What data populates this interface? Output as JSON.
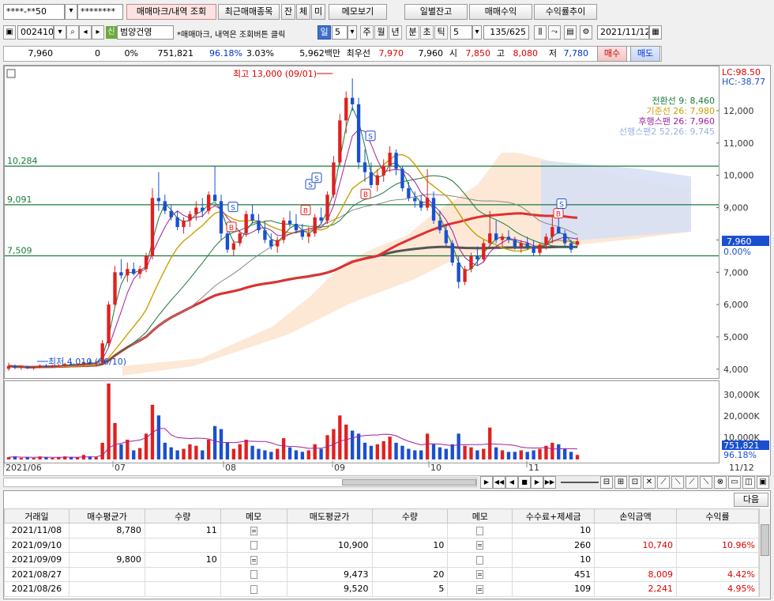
{
  "toolbar": {
    "account_field": "****-**50",
    "password_field": "********",
    "buttons": [
      "매매마크/내역 조회",
      "최근매매종목",
      "잔",
      "체",
      "미",
      "메모보기"
    ],
    "right_buttons": [
      "일별잔고",
      "매매수익",
      "수익률추이"
    ]
  },
  "row2": {
    "code": "002410",
    "credit_tag": "신",
    "stock_name": "범양건영",
    "notice": "*매매마크, 내역은 조회버튼 클릭",
    "period_sel": "일",
    "period_num": "5",
    "periods": [
      "주",
      "월",
      "년",
      "분",
      "초",
      "틱"
    ],
    "tick_num": "5",
    "count": "135/625",
    "date": "2021/11/12"
  },
  "quote": {
    "price": "7,960",
    "change": "0",
    "change_pct": "0%",
    "volume": "751,821",
    "vol_ratio": "96.18%",
    "turnover": "3.03%",
    "amount": "5,962백만",
    "best_label": "최우선",
    "best_ask": "7,970",
    "best_bid": "7,960",
    "open_label": "시",
    "open": "7,850",
    "high_label": "고",
    "high": "8,080",
    "low_label": "저",
    "low": "7,780",
    "buy_btn": "매수",
    "sell_btn": "매도"
  },
  "chart_data": {
    "type": "candlestick",
    "y_ticks": [
      "12,000",
      "11,000",
      "10,000",
      "9,000",
      "8,000",
      "7,000",
      "6,000",
      "5,000",
      "4,000"
    ],
    "vol_ticks": [
      "30,000K",
      "20,000K",
      "10,000K"
    ],
    "x_labels": [
      "2021/06",
      "07",
      "08",
      "09",
      "10",
      "11",
      "11/12"
    ],
    "hlines": [
      {
        "label": "10,284",
        "value": 10284
      },
      {
        "label": "9,091",
        "value": 9091
      },
      {
        "label": "7,509",
        "value": 7509
      }
    ],
    "annotations": {
      "high": "최고 13,000 (09/01)",
      "low": "최저 4,010 (06/10)",
      "lc": "LC:98.50",
      "hc": "HC:-38.77",
      "current": "7,960",
      "current_pct": "0.00%",
      "vol_current": "751,821",
      "vol_pct": "96.18%"
    },
    "legend": [
      {
        "name": "전환선 9: 8,460",
        "color": "#1a7a3a"
      },
      {
        "name": "기준선 26: 7,980",
        "color": "#c8a000"
      },
      {
        "name": "후행스팬 26: 7,960",
        "color": "#a020a0"
      },
      {
        "name": "선행스팬2 52,26: 9,745",
        "color": "#9bb0e0"
      }
    ],
    "candles": [
      [
        4010,
        4200,
        3950,
        4100
      ],
      [
        4100,
        4150,
        4000,
        4050
      ],
      [
        4050,
        4120,
        3980,
        4080
      ],
      [
        4080,
        4100,
        4000,
        4030
      ],
      [
        4030,
        4100,
        3980,
        4060
      ],
      [
        4060,
        4150,
        4020,
        4110
      ],
      [
        4110,
        4160,
        4050,
        4080
      ],
      [
        4080,
        4140,
        4040,
        4100
      ],
      [
        4100,
        4180,
        4060,
        4120
      ],
      [
        4120,
        4200,
        4080,
        4160
      ],
      [
        4160,
        4200,
        4100,
        4130
      ],
      [
        4130,
        4190,
        4090,
        4150
      ],
      [
        4150,
        4260,
        4100,
        4220
      ],
      [
        4220,
        4300,
        4150,
        4180
      ],
      [
        4180,
        4250,
        4120,
        4200
      ],
      [
        4200,
        4900,
        4150,
        4800
      ],
      [
        4800,
        6100,
        4700,
        6000
      ],
      [
        6000,
        7200,
        5900,
        7000
      ],
      [
        7000,
        7400,
        6800,
        6900
      ],
      [
        6900,
        7300,
        6700,
        7100
      ],
      [
        7100,
        7300,
        6900,
        6950
      ],
      [
        6950,
        7200,
        6800,
        7100
      ],
      [
        7100,
        7600,
        7000,
        7500
      ],
      [
        7500,
        9600,
        7400,
        9300
      ],
      [
        9300,
        10100,
        8900,
        9200
      ],
      [
        9200,
        9400,
        8800,
        8900
      ],
      [
        8900,
        9100,
        8600,
        8700
      ],
      [
        8700,
        8900,
        8300,
        8400
      ],
      [
        8400,
        8700,
        8200,
        8600
      ],
      [
        8600,
        8900,
        8400,
        8800
      ],
      [
        8800,
        9200,
        8600,
        9000
      ],
      [
        9000,
        9300,
        8700,
        8900
      ],
      [
        8900,
        9500,
        8800,
        9400
      ],
      [
        9400,
        10300,
        9300,
        9200
      ],
      [
        9200,
        9400,
        8000,
        8200
      ],
      [
        8200,
        8400,
        7600,
        7700
      ],
      [
        7700,
        8000,
        7500,
        7900
      ],
      [
        7900,
        8300,
        7800,
        8200
      ],
      [
        8200,
        8900,
        8100,
        8800
      ],
      [
        8800,
        9100,
        8500,
        8600
      ],
      [
        8600,
        8800,
        8200,
        8300
      ],
      [
        8300,
        8600,
        7900,
        8000
      ],
      [
        8000,
        8200,
        7700,
        7800
      ],
      [
        7800,
        8100,
        7600,
        8000
      ],
      [
        8000,
        8700,
        7900,
        8600
      ],
      [
        8600,
        8900,
        8400,
        8500
      ],
      [
        8500,
        8800,
        8200,
        8300
      ],
      [
        8300,
        8500,
        8000,
        8100
      ],
      [
        8100,
        8400,
        7900,
        8200
      ],
      [
        8200,
        8800,
        8100,
        8700
      ],
      [
        8700,
        9000,
        8500,
        8600
      ],
      [
        8600,
        9500,
        8500,
        9400
      ],
      [
        9400,
        10600,
        9300,
        10400
      ],
      [
        10400,
        11900,
        10300,
        11700
      ],
      [
        11700,
        12600,
        11300,
        12400
      ],
      [
        12400,
        13000,
        12000,
        12200
      ],
      [
        12200,
        12400,
        10200,
        10400
      ],
      [
        10400,
        10800,
        9800,
        10100
      ],
      [
        10100,
        10400,
        9600,
        9700
      ],
      [
        9700,
        10200,
        9500,
        10000
      ],
      [
        10000,
        10500,
        9800,
        10300
      ],
      [
        10300,
        10900,
        10100,
        10700
      ],
      [
        10700,
        10800,
        10000,
        10200
      ],
      [
        10200,
        10300,
        9500,
        9600
      ],
      [
        9600,
        9800,
        9200,
        9300
      ],
      [
        9300,
        9500,
        9000,
        9200
      ],
      [
        9200,
        9400,
        8900,
        9000
      ],
      [
        9000,
        10200,
        8900,
        9300
      ],
      [
        9300,
        9500,
        8500,
        8600
      ],
      [
        8600,
        8900,
        8200,
        8300
      ],
      [
        8300,
        8500,
        7800,
        7900
      ],
      [
        7900,
        8000,
        7200,
        7300
      ],
      [
        7300,
        7500,
        6500,
        6700
      ],
      [
        6700,
        7200,
        6600,
        7100
      ],
      [
        7100,
        7600,
        7000,
        7500
      ],
      [
        7500,
        7800,
        7200,
        7400
      ],
      [
        7400,
        8000,
        7300,
        7900
      ],
      [
        7900,
        8900,
        7800,
        8200
      ],
      [
        8200,
        8600,
        7900,
        8000
      ],
      [
        8000,
        8200,
        7800,
        8100
      ],
      [
        8100,
        8300,
        7900,
        8000
      ],
      [
        8000,
        8100,
        7700,
        7800
      ],
      [
        7800,
        8000,
        7600,
        7900
      ],
      [
        7900,
        8100,
        7700,
        7800
      ],
      [
        7800,
        8000,
        7500,
        7600
      ],
      [
        7600,
        7900,
        7500,
        7850
      ],
      [
        7850,
        8200,
        7700,
        8100
      ],
      [
        8100,
        8700,
        7900,
        8400
      ],
      [
        8400,
        9000,
        8200,
        8200
      ],
      [
        8200,
        8300,
        7800,
        7900
      ],
      [
        7900,
        8000,
        7600,
        7700
      ],
      [
        7850,
        8080,
        7780,
        7960
      ]
    ],
    "volume_pct": [
      3,
      4,
      2,
      3,
      2,
      4,
      3,
      2,
      3,
      4,
      3,
      3,
      6,
      4,
      3,
      22,
      100,
      48,
      20,
      26,
      12,
      15,
      34,
      72,
      58,
      22,
      16,
      12,
      14,
      20,
      18,
      12,
      26,
      44,
      40,
      22,
      14,
      20,
      26,
      18,
      14,
      12,
      10,
      14,
      28,
      16,
      12,
      10,
      12,
      20,
      14,
      32,
      40,
      58,
      46,
      38,
      34,
      22,
      18,
      20,
      24,
      30,
      22,
      18,
      14,
      12,
      12,
      34,
      20,
      16,
      14,
      20,
      34,
      18,
      16,
      12,
      14,
      42,
      16,
      12,
      10,
      10,
      12,
      10,
      12,
      14,
      18,
      22,
      20,
      14,
      10,
      6
    ]
  },
  "chart_bottom": {
    "nav_buttons": [
      "▶",
      "◀◀",
      "◀",
      "■",
      "▶",
      "▶▶"
    ]
  },
  "grid": {
    "next_btn": "다음",
    "headers": [
      "거래일",
      "매수평균가",
      "수량",
      "메모",
      "매도평균가",
      "수량",
      "메모",
      "수수료+제세금",
      "손익금액",
      "수익률"
    ],
    "rows": [
      {
        "date": "2021/11/08",
        "buy_avg": "8,780",
        "buy_qty": "11",
        "buy_memo": true,
        "sell_avg": "",
        "sell_qty": "",
        "sell_memo": false,
        "fee": "10",
        "pnl": "",
        "ret": ""
      },
      {
        "date": "2021/09/10",
        "buy_avg": "",
        "buy_qty": "",
        "buy_memo": false,
        "sell_avg": "10,900",
        "sell_qty": "10",
        "sell_memo": true,
        "fee": "260",
        "pnl": "10,740",
        "ret": "10.96%"
      },
      {
        "date": "2021/09/09",
        "buy_avg": "9,800",
        "buy_qty": "10",
        "buy_memo": true,
        "sell_avg": "",
        "sell_qty": "",
        "sell_memo": false,
        "fee": "10",
        "pnl": "",
        "ret": ""
      },
      {
        "date": "2021/08/27",
        "buy_avg": "",
        "buy_qty": "",
        "buy_memo": false,
        "sell_avg": "9,473",
        "sell_qty": "20",
        "sell_memo": true,
        "fee": "451",
        "pnl": "8,009",
        "ret": "4.42%"
      },
      {
        "date": "2021/08/26",
        "buy_avg": "",
        "buy_qty": "",
        "buy_memo": false,
        "sell_avg": "9,520",
        "sell_qty": "5",
        "sell_memo": true,
        "fee": "109",
        "pnl": "2,241",
        "ret": "4.95%"
      }
    ]
  }
}
